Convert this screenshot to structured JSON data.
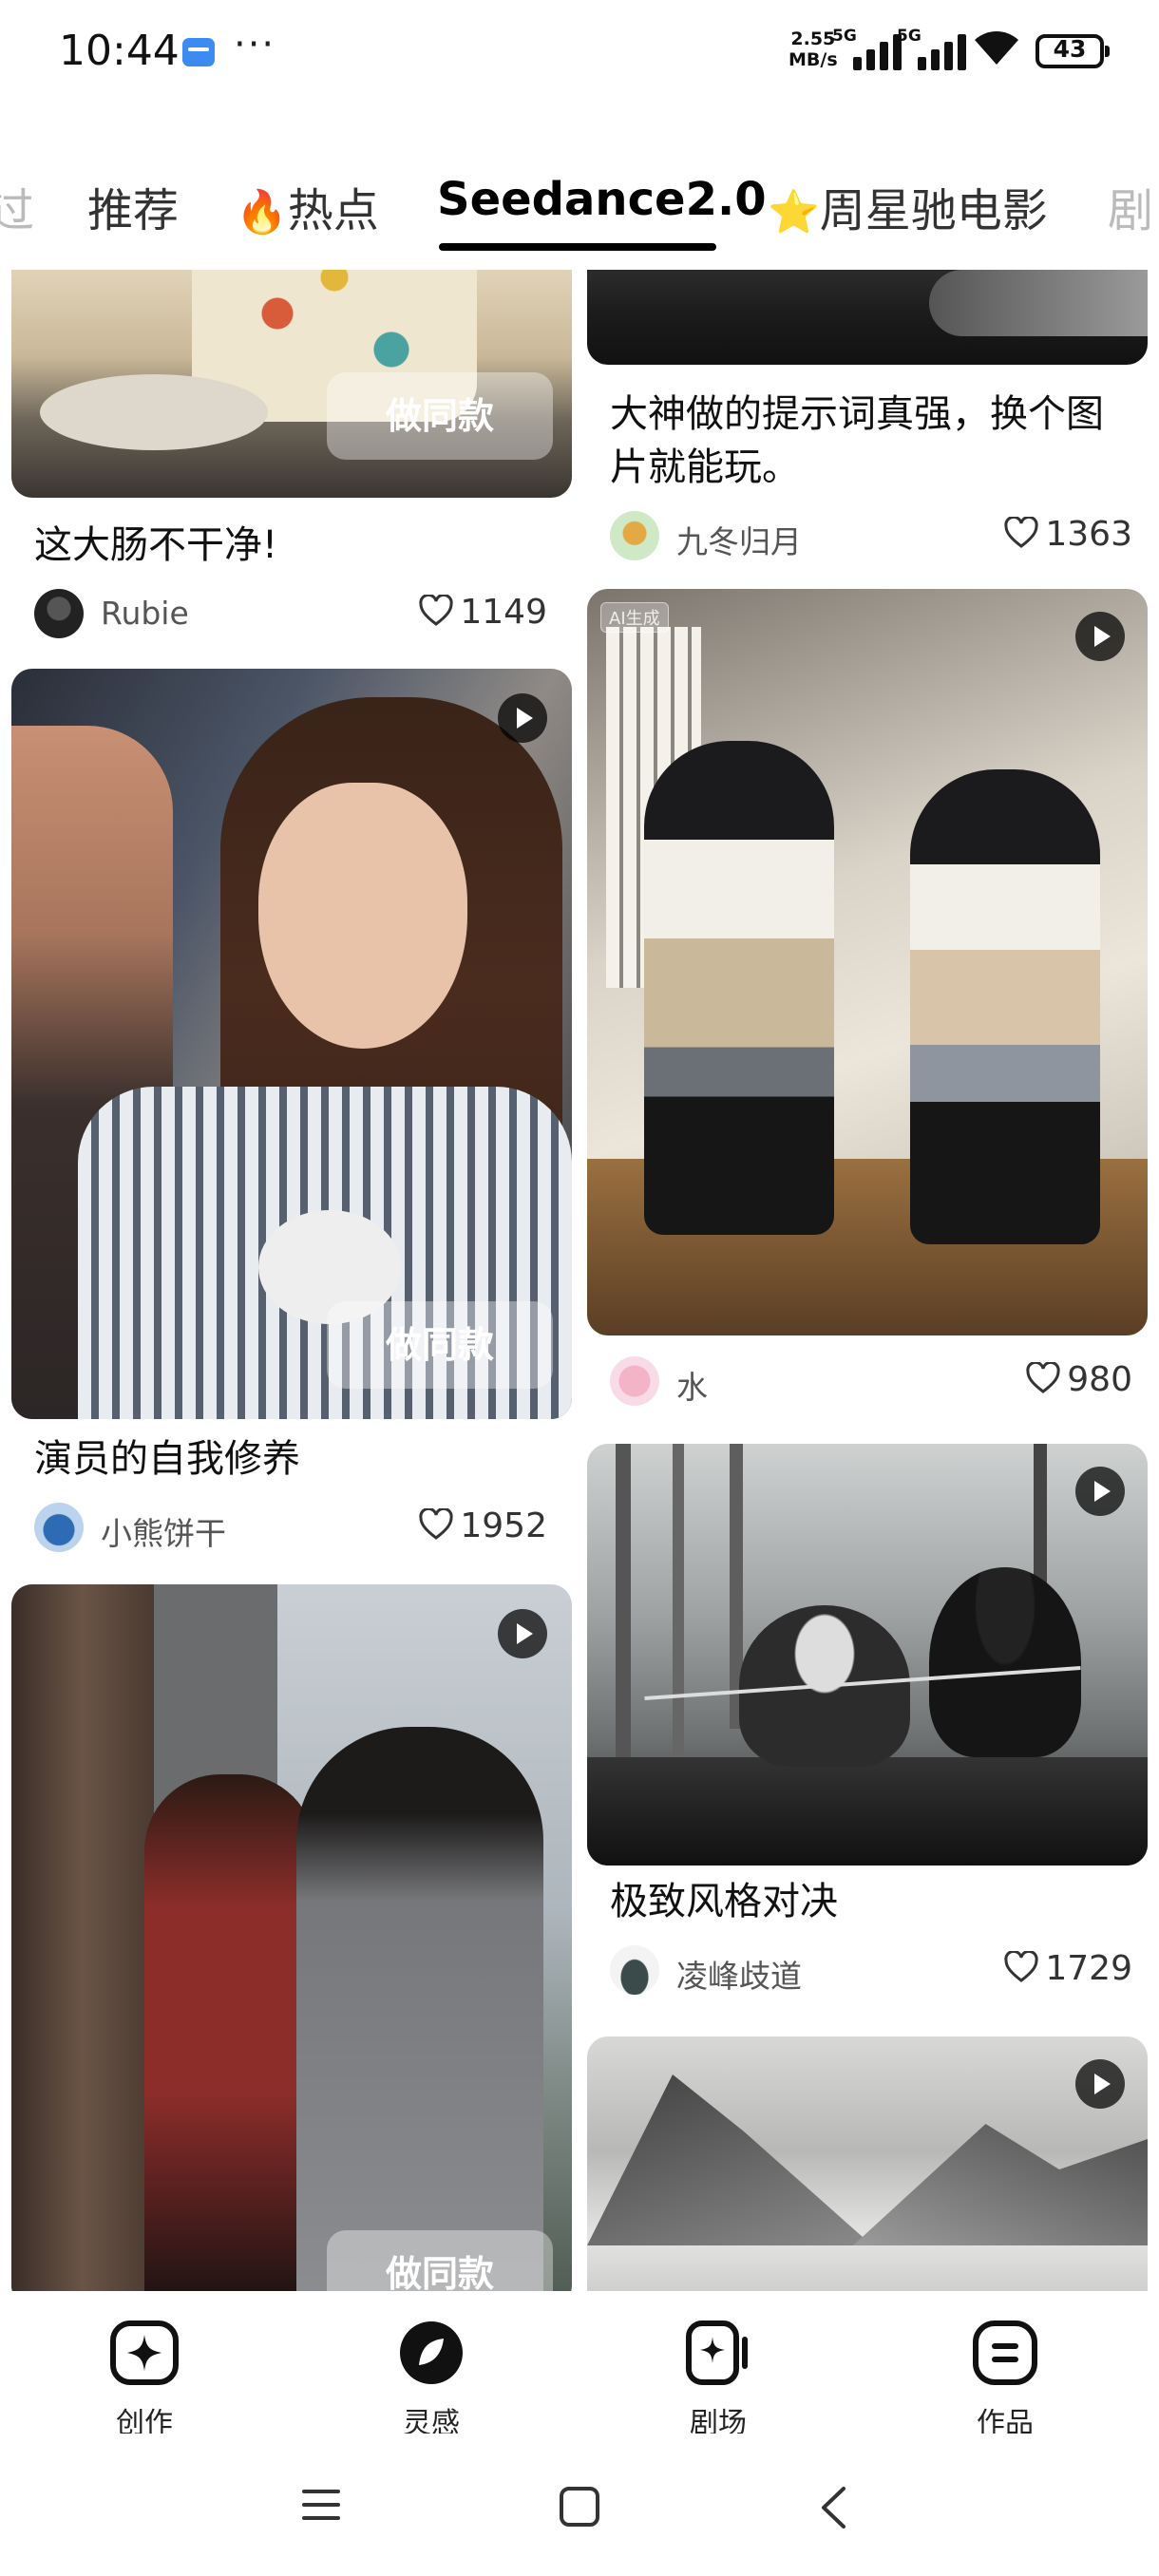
{
  "status_bar": {
    "time": "10:44",
    "more_dots": "···",
    "speed_value": "2.55",
    "speed_unit": "MB/s",
    "signal_1_label": "5G",
    "signal_2_label": "5G",
    "battery": "43"
  },
  "tabs": {
    "partial_left": "过",
    "items": [
      "推荐",
      "热点",
      "Seedance2.0",
      "周星驰电影"
    ],
    "partial_right": "剧",
    "active_index": 2
  },
  "feed": {
    "same_style_label": "做同款",
    "ai_tag": "AI生成",
    "cards": [
      {
        "title": "这大肠不干净!",
        "author": "Rubie",
        "likes": "1149"
      },
      {
        "title": "大神做的提示词真强，换个图片就能玩。",
        "author": "九冬归月",
        "likes": "1363"
      },
      {
        "title": "",
        "author": "水",
        "likes": "980"
      },
      {
        "title": "演员的自我修养",
        "author": "小熊饼干",
        "likes": "1952"
      },
      {
        "title": "极致风格对决",
        "author": "凌峰歧道",
        "likes": "1729"
      }
    ]
  },
  "bottom_nav": {
    "items": [
      {
        "label": "创作",
        "icon": "create-sparkle-icon"
      },
      {
        "label": "灵感",
        "icon": "inspiration-leaf-icon"
      },
      {
        "label": "剧场",
        "icon": "theater-icon"
      },
      {
        "label": "作品",
        "icon": "works-icon"
      }
    ]
  },
  "system_nav": {
    "icons": [
      "menu-icon",
      "home-icon",
      "back-icon"
    ]
  }
}
